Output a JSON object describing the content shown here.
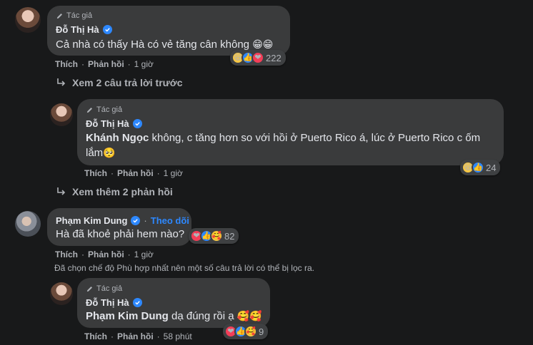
{
  "comments": [
    {
      "author_tag": "Tác giả",
      "name": "Đỗ Thị Hà",
      "text": "Cả nhà có thấy Hà có vẻ tăng cân không",
      "inline_emojis": "😁😁",
      "like": "Thích",
      "reply": "Phản hồi",
      "time": "1 giờ",
      "reaction_count": "222",
      "reactions": [
        "haha",
        "like",
        "love"
      ]
    },
    {
      "author_tag": "Tác giả",
      "name": "Đỗ Thị Hà",
      "mention": "Khánh Ngọc",
      "text_line1": " không, c tăng hơn so với hồi ở Puerto Rico á, lúc ở Puerto Rico c ốm",
      "text_line2": "lắm",
      "inline_emojis": "🥺",
      "like": "Thích",
      "reply": "Phản hồi",
      "time": "1 giờ",
      "reaction_count": "24",
      "reactions": [
        "haha",
        "like"
      ]
    },
    {
      "name": "Phạm Kim Dung",
      "follow": "Theo dõi",
      "text": "Hà đã khoẻ phải hem nào?",
      "like": "Thích",
      "reply": "Phản hồi",
      "time": "1 giờ",
      "reaction_count": "82",
      "reactions": [
        "love",
        "like",
        "care"
      ]
    },
    {
      "author_tag": "Tác giả",
      "name": "Đỗ Thị Hà",
      "mention": "Phạm Kim Dung",
      "text": " dạ đúng rồi ạ",
      "inline_emojis": "🥰🥰",
      "like": "Thích",
      "reply": "Phản hồi",
      "time": "58 phút",
      "reaction_count": "9",
      "reactions": [
        "love",
        "like",
        "care"
      ]
    }
  ],
  "links": {
    "see_previous": "Xem 2 câu trả lời trước",
    "see_more": "Xem thêm 2 phản hồi"
  },
  "filter_note": "Đã chọn chế độ Phù hợp nhất nên một số câu trả lời có thể bị lọc ra.",
  "colors": {
    "background": "#18191a",
    "bubble": "#3a3b3c",
    "accent": "#2d88ff",
    "secondary_text": "#b0b3b8"
  },
  "icons": {
    "author_badge": "pencil-icon",
    "verified": "verified-check-icon",
    "reply_arrow": "reply-arrow-icon"
  }
}
